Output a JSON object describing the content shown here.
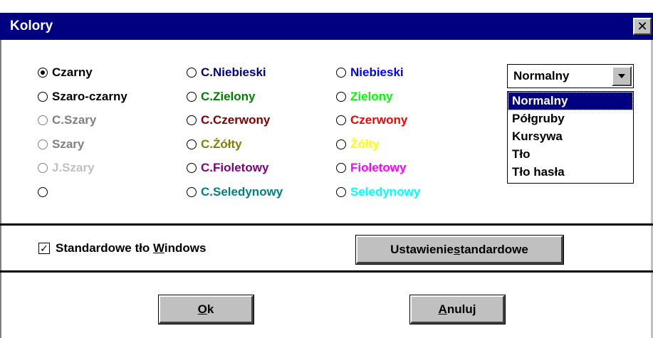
{
  "window": {
    "title": "Kolory",
    "close_glyph": "✕"
  },
  "colors": {
    "title_bg": "#000080",
    "button_face": "#c0c0c0"
  },
  "radios": {
    "column1": [
      {
        "label": "Czarny",
        "color": "#000000",
        "checked": true
      },
      {
        "label": "Szaro-czarny",
        "color": "#000000",
        "checked": false
      },
      {
        "label": "C.Szary",
        "color": "#808080",
        "checked": false
      },
      {
        "label": "Szary",
        "color": "#808080",
        "checked": false
      },
      {
        "label": "J.Szary",
        "color": "#c0c0c0",
        "checked": false
      },
      {
        "label": "",
        "color": "#ffffff",
        "checked": false
      }
    ],
    "column2": [
      {
        "label": "C.Niebieski",
        "color": "#000080",
        "checked": false
      },
      {
        "label": "C.Zielony",
        "color": "#008000",
        "checked": false
      },
      {
        "label": "C.Czerwony",
        "color": "#800000",
        "checked": false
      },
      {
        "label": "C.Żółty",
        "color": "#808000",
        "checked": false
      },
      {
        "label": "C.Fioletowy",
        "color": "#800080",
        "checked": false
      },
      {
        "label": "C.Seledynowy",
        "color": "#008080",
        "checked": false
      }
    ],
    "column3": [
      {
        "label": "Niebieski",
        "color": "#0000ff",
        "checked": false
      },
      {
        "label": "Zielony",
        "color": "#00ff00",
        "checked": false
      },
      {
        "label": "Czerwony",
        "color": "#ff0000",
        "checked": false
      },
      {
        "label": "Żółty",
        "color": "#ffff00",
        "checked": false
      },
      {
        "label": "Fioletowy",
        "color": "#ff00ff",
        "checked": false
      },
      {
        "label": "Seledynowy",
        "color": "#00ffff",
        "checked": false
      }
    ]
  },
  "style_dropdown": {
    "selected": "Normalny",
    "options": [
      "Normalny",
      "Półgruby",
      "Kursywa",
      "Tło",
      "Tło hasła"
    ],
    "highlighted_index": 0
  },
  "checkbox": {
    "label_before": "Standardowe tło ",
    "label_mnemonic": "W",
    "label_after": "indows",
    "checked": true,
    "check_glyph": "✓"
  },
  "buttons": {
    "reset": {
      "before": "Ustawienie ",
      "mnemonic": "s",
      "after": "tandardowe"
    },
    "ok": {
      "before": "",
      "mnemonic": "O",
      "after": "k"
    },
    "cancel": {
      "before": "",
      "mnemonic": "A",
      "after": "nuluj"
    }
  }
}
